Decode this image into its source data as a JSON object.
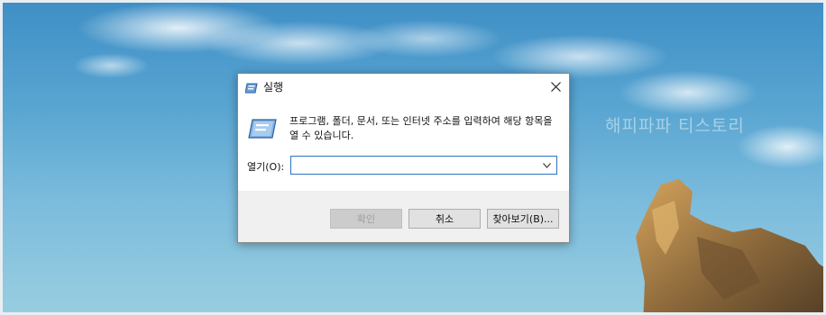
{
  "watermark": "해피파파 티스토리",
  "dialog": {
    "title": "실행",
    "description": "프로그램, 폴더, 문서, 또는 인터넷 주소를 입력하여 해당 항목을 열 수 있습니다.",
    "open_label": "열기(O):",
    "open_value": "",
    "buttons": {
      "ok": "확인",
      "cancel": "취소",
      "browse": "찾아보기(B)..."
    }
  },
  "icons": {
    "title": "run-icon",
    "large": "run-large-icon",
    "close": "close-icon",
    "dropdown": "chevron-down-icon"
  },
  "colors": {
    "input_border": "#2a73c3",
    "footer_bg": "#f0f0f0",
    "disabled_text": "#a0a0a0"
  }
}
